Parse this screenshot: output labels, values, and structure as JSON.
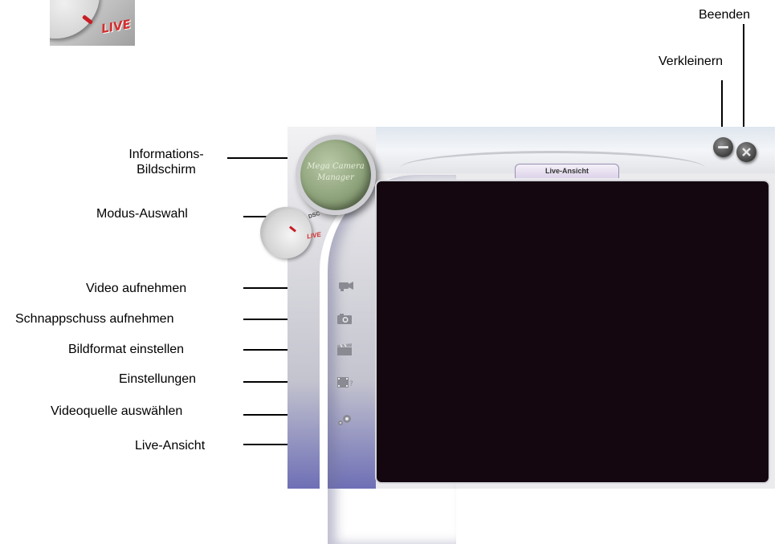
{
  "inset": {
    "label": "LIVE",
    "icon": "mode-dial-icon"
  },
  "window_controls": {
    "close_label": "Beenden",
    "minimize_label": "Verkleinern"
  },
  "callouts": {
    "info_line1": "Informations-",
    "info_line2": "Bildschirm",
    "mode": "Modus-Auswahl",
    "video": "Video aufnehmen",
    "snapshot": "Schnappschuss aufnehmen",
    "format": "Bildformat einstellen",
    "settings": "Einstellungen",
    "source": "Videoquelle auswählen",
    "liveview": "Live-Ansicht"
  },
  "app": {
    "info_screen_line1": "Mega Camera",
    "info_screen_line2": "Manager",
    "mode_dsc": "DSC",
    "mode_live": "LIVE",
    "tab_label": "Live-Ansicht",
    "sidebar_icons": [
      "video-camera-icon",
      "snapshot-camera-icon",
      "image-format-icon",
      "settings-film-icon",
      "video-source-gear-icon"
    ]
  },
  "colors": {
    "live_red": "#d42f2f",
    "view_bg": "#140710",
    "sidebar_blue": "#6e6fb5"
  }
}
